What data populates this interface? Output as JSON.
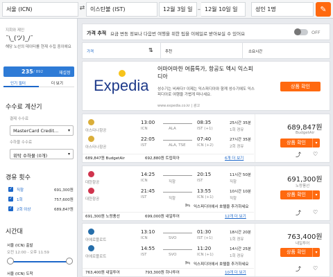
{
  "search": {
    "origin": "서울 (ICN)",
    "swap": "⇄",
    "destination": "이스탄불 (IST)",
    "depart": "12월 3일 일",
    "return": "12월 10일 일",
    "passengers": "성인 1명",
    "edit_icon": "pencil-icon"
  },
  "sidebar": {
    "ascii_title": "지회와 제인",
    "ascii_face": "¯\\_(ツ)_/¯",
    "notice": "해당 노선의 데이터를 현재 수집 중이에요",
    "count": "235",
    "total": "/ 892",
    "reset": "재설정",
    "tab_popular": "인기 필터",
    "tab_more": "더 보기",
    "fee_calc_title": "수수료 계산기",
    "payment_label": "결제 수수료",
    "payment_value": "MasterCard Credit...",
    "ticket_label": "수하물 수수료",
    "ticket_value": "위탁 수하물 (0개)",
    "stops_title": "경유 횟수",
    "stops": [
      {
        "label": "직항",
        "price": "691,300원"
      },
      {
        "label": "1회",
        "price": "757,600원"
      },
      {
        "label": "2회 이상",
        "price": "689,847원"
      }
    ],
    "time_title": "시간대",
    "depart_label": "서울 (ICN) 출발",
    "depart_range": "오전 12:00 - 오후 11:59",
    "arrive_label": "서울 (ICN) 도착"
  },
  "alert": {
    "title": "가격 추적",
    "text": "요금 변동 정보나 다음번 여행을 위한 팁을 이메일로 받아보실 수 있어요",
    "toggle": "OFF"
  },
  "sortbar": {
    "price": "가격",
    "recommended": "추천",
    "duration": "소요시간"
  },
  "ad": {
    "logo": "Expedia",
    "headline": "어마어마한 여름특가, 항공도 엑시 익스피디아",
    "body": "성수기는 비싸다? 이제는 익스피디아와 함께 성수기에도 익스피디아로 여행을 가볍게 떠나세요.",
    "url": "www.expedia.co.kr | 광고",
    "button": "상품 확인"
  },
  "results": [
    {
      "legs": [
        {
          "airline": "아스타나항공",
          "dep_time": "13:00",
          "dep_ap": "ICN",
          "via": "ALA",
          "arr_time": "08:35",
          "arr_ap": "IST (+1)",
          "duration": "25시간 35분",
          "stops": "1회 경유"
        },
        {
          "airline": "아스타나항공",
          "dep_time": "22:05",
          "dep_ap": "IST",
          "via": "ALA, TSE",
          "arr_time": "07:40",
          "arr_ap": "ICN (+2)",
          "duration": "27시간 35분",
          "stops": "2회 경유"
        }
      ],
      "footer_left": "689,847원 BudgetAir",
      "footer_mid": "692,880원 트립피아",
      "footer_more": "6개 더 보기",
      "price": "689,847원",
      "vendor": "BudgetAir",
      "button": "상품 확인"
    },
    {
      "legs": [
        {
          "airline": "대한항공",
          "dep_time": "14:25",
          "dep_ap": "ICN",
          "via": "직항",
          "arr_time": "20:15",
          "arr_ap": "IST",
          "duration": "11시간 50분",
          "stops": "직항"
        },
        {
          "airline": "대한항공",
          "dep_time": "21:45",
          "dep_ap": "IST",
          "via": "직항",
          "arr_time": "13:55",
          "arr_ap": "ICN (+1)",
          "duration": "10시간 10분",
          "stops": "직항"
        }
      ],
      "hotel_note": "익스피디아에서 호텔을 추가하세요",
      "footer_left": "691,300원 노랑풍선",
      "footer_mid": "699,000원 내일투어",
      "footer_more": "12개 더 보기",
      "price": "691,300원",
      "vendor": "노랑풍선",
      "button": "상품 확인"
    },
    {
      "legs": [
        {
          "airline": "아에로플로트",
          "dep_time": "13:10",
          "dep_ap": "ICN",
          "via": "SVO",
          "arr_time": "01:30",
          "arr_ap": "IST (+1)",
          "duration": "18시간 20분",
          "stops": "1회 경유"
        },
        {
          "airline": "아에로플로트",
          "dep_time": "14:55",
          "dep_ap": "IST",
          "via": "SVO",
          "arr_time": "11:20",
          "arr_ap": "ICN (+1)",
          "duration": "14시간 25분",
          "stops": "1회 경유"
        }
      ],
      "hotel_note": "익스피디아에서 호텔을 추가하세요",
      "footer_left": "763,400원 내일투어",
      "footer_mid": "793,300원 하나투어",
      "footer_more": "10개 더 보기",
      "price": "763,400원",
      "vendor": "내일투어",
      "button": "상품 확인"
    }
  ],
  "colors": {
    "accent": "#ff690f",
    "blue": "#1c67c9"
  }
}
